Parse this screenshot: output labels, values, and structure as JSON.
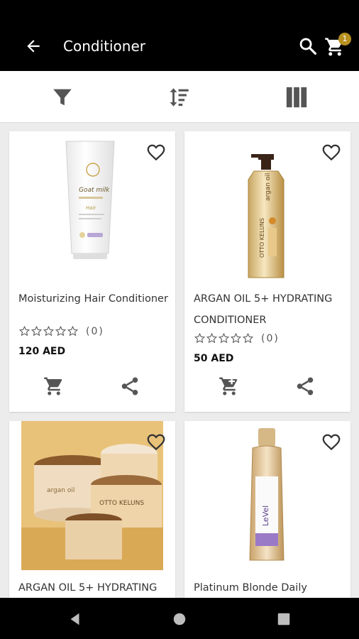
{
  "app_bar": {
    "title": "Conditioner",
    "cart_badge": "1",
    "icons": [
      "back-arrow-icon",
      "search-icon",
      "cart-icon"
    ],
    "badge_color": "#b8901f"
  },
  "toolbar": {
    "icons": [
      "filter-icon",
      "sort-icon",
      "grid-view-icon"
    ]
  },
  "products": [
    {
      "name": "Moisturizing Hair Conditioner",
      "rating": 0,
      "reviews": "(0)",
      "price": "120 AED"
    },
    {
      "name_line1": "ARGAN OIL 5+ HYDRATING",
      "name_line2": "CONDITIONER",
      "rating": 0,
      "reviews": "(0)",
      "price": "50 AED"
    },
    {
      "name": "ARGAN OIL 5+ HYDRATING"
    },
    {
      "name": "Platinum Blonde Daily"
    }
  ],
  "system_nav": {
    "icons": [
      "nav-back-icon",
      "nav-home-icon",
      "nav-recents-icon"
    ]
  }
}
